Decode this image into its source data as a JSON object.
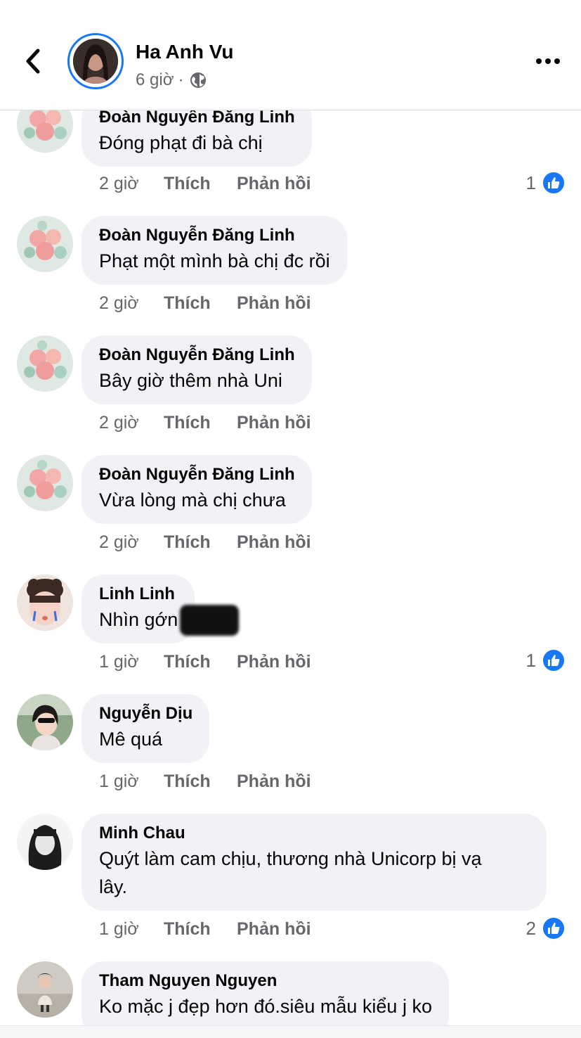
{
  "header": {
    "author_name": "Ha Anh Vu",
    "time": "6 giờ",
    "separator": "·"
  },
  "comments": [
    {
      "author": "Đoàn Nguyên Đăng Linh",
      "text": "Đóng phạt đi bà chị",
      "time": "2 giờ",
      "like_label": "Thích",
      "reply_label": "Phản hồi",
      "reactions": "1"
    },
    {
      "author": "Đoàn Nguyễn Đăng Linh",
      "text": "Phạt một mình bà chị đc rồi",
      "time": "2 giờ",
      "like_label": "Thích",
      "reply_label": "Phản hồi"
    },
    {
      "author": "Đoàn Nguyễn Đăng Linh",
      "text": "Bây giờ thêm nhà Uni",
      "time": "2 giờ",
      "like_label": "Thích",
      "reply_label": "Phản hồi"
    },
    {
      "author": "Đoàn Nguyễn Đăng Linh",
      "text": "Vừa lòng mà chị chưa",
      "time": "2 giờ",
      "like_label": "Thích",
      "reply_label": "Phản hồi"
    },
    {
      "author": "Linh Linh",
      "text": "Nhìn gớn",
      "time": "1 giờ",
      "like_label": "Thích",
      "reply_label": "Phản hồi",
      "reactions": "1"
    },
    {
      "author": "Nguyễn Dịu",
      "text": "Mê quá",
      "time": "1 giờ",
      "like_label": "Thích",
      "reply_label": "Phản hồi"
    },
    {
      "author": "Minh Chau",
      "text_line1": "Quýt làm cam chịu, thương nhà Unicorp bị vạ",
      "text_line2": "lây.",
      "time": "1 giờ",
      "like_label": "Thích",
      "reply_label": "Phản hồi",
      "reactions": "2"
    },
    {
      "author": "Tham Nguyen Nguyen",
      "text": "Ko mặc j đẹp hơn đó.siêu mẫu kiểu j ko"
    }
  ],
  "colors": {
    "accent": "#1877f2",
    "bubble": "#f0f2f5",
    "muted": "#65676b",
    "text": "#050505"
  },
  "icons": [
    "back-arrow-icon",
    "globe-icon",
    "more-icon",
    "like-thumb-icon"
  ]
}
